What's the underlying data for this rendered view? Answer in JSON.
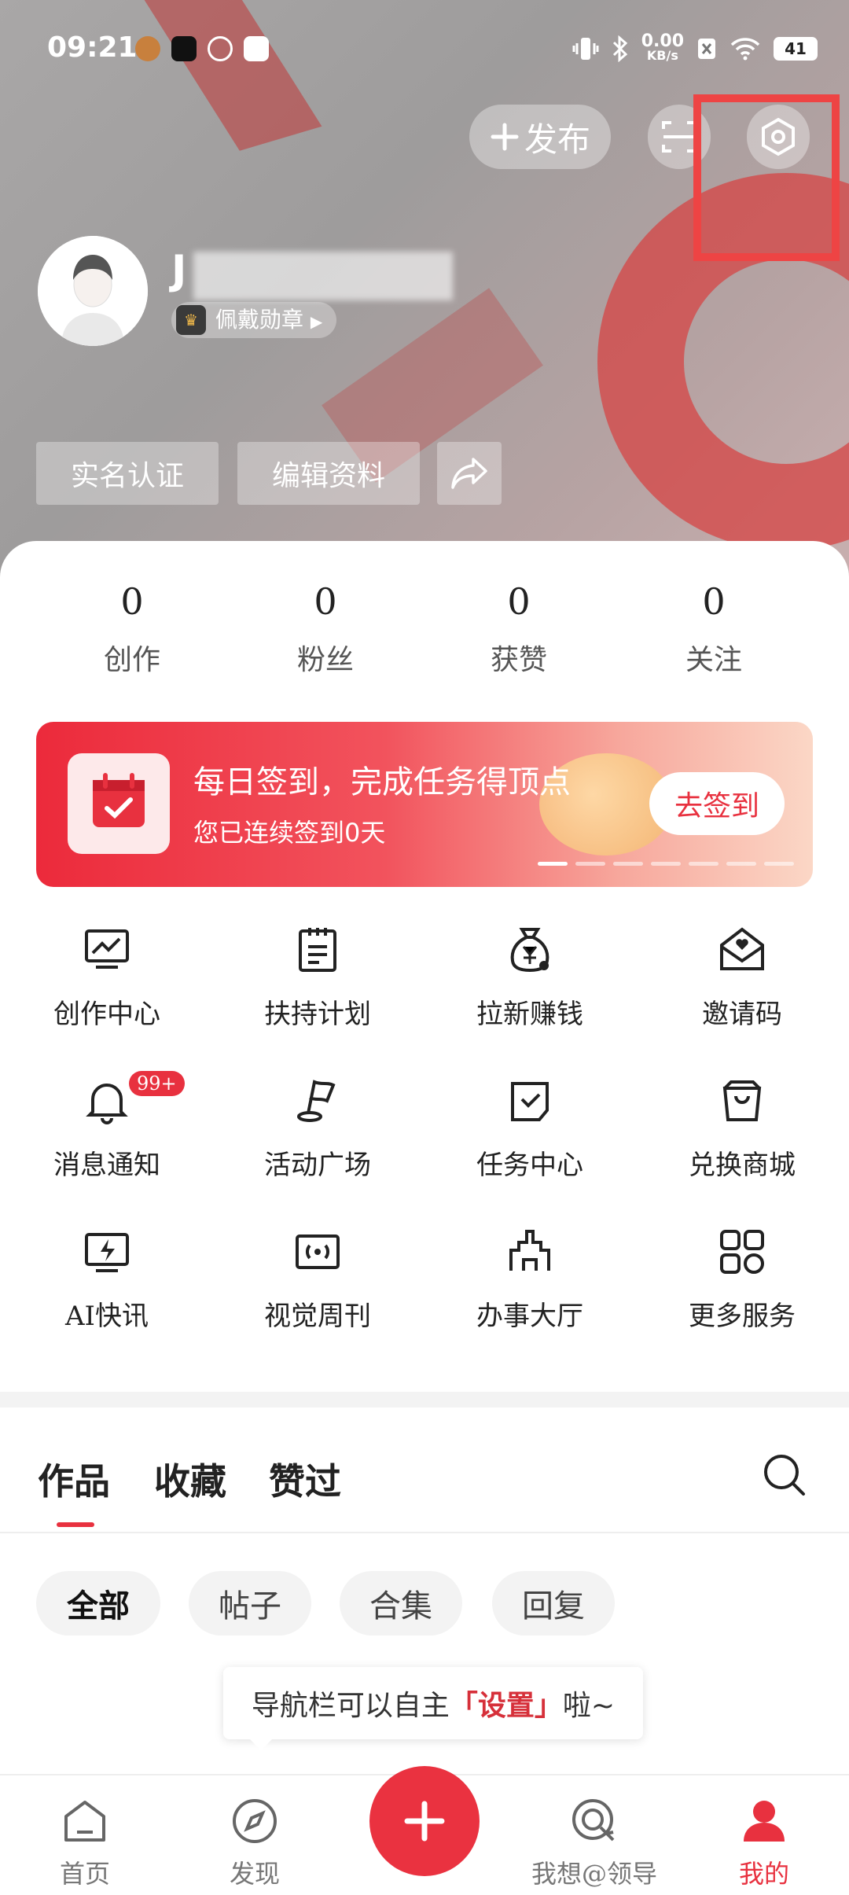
{
  "status_bar": {
    "time": "09:21",
    "net_speed_value": "0.00",
    "net_speed_unit": "KB/s",
    "battery": "41"
  },
  "header": {
    "publish_label": "发布"
  },
  "profile": {
    "username": "J",
    "medal_label": "佩戴勋章",
    "buttons": [
      "实名认证",
      "编辑资料"
    ]
  },
  "stats": [
    {
      "value": "0",
      "label": "创作"
    },
    {
      "value": "0",
      "label": "粉丝"
    },
    {
      "value": "0",
      "label": "获赞"
    },
    {
      "value": "0",
      "label": "关注"
    }
  ],
  "checkin_banner": {
    "title": "每日签到，完成任务得顶点",
    "subtitle": "您已连续签到0天",
    "button": "去签到"
  },
  "services": [
    {
      "label": "创作中心",
      "icon": "chart-monitor-icon"
    },
    {
      "label": "扶持计划",
      "icon": "clipboard-icon"
    },
    {
      "label": "拉新赚钱",
      "icon": "money-bag-icon"
    },
    {
      "label": "邀请码",
      "icon": "envelope-heart-icon"
    },
    {
      "label": "消息通知",
      "icon": "bell-icon",
      "badge": "99+"
    },
    {
      "label": "活动广场",
      "icon": "flag-icon"
    },
    {
      "label": "任务中心",
      "icon": "task-check-icon"
    },
    {
      "label": "兑换商城",
      "icon": "shopping-bag-icon"
    },
    {
      "label": "AI快讯",
      "icon": "flash-monitor-icon"
    },
    {
      "label": "视觉周刊",
      "icon": "broadcast-icon"
    },
    {
      "label": "办事大厅",
      "icon": "building-icon"
    },
    {
      "label": "更多服务",
      "icon": "grid-icon"
    }
  ],
  "content_tabs": [
    "作品",
    "收藏",
    "赞过"
  ],
  "filter_chips": [
    "全部",
    "帖子",
    "合集",
    "回复"
  ],
  "tooltip": {
    "prefix": "导航栏可以自主",
    "emphasis": "「设置」",
    "suffix": "啦~"
  },
  "bottom_nav": [
    {
      "label": "首页",
      "icon": "home-icon"
    },
    {
      "label": "发现",
      "icon": "compass-icon"
    },
    {
      "label": "我想@领导",
      "icon": "speech-target-icon"
    },
    {
      "label": "我的",
      "icon": "user-icon"
    }
  ],
  "colors": {
    "accent": "#e8313f",
    "highlight_box": "#ee4444"
  }
}
